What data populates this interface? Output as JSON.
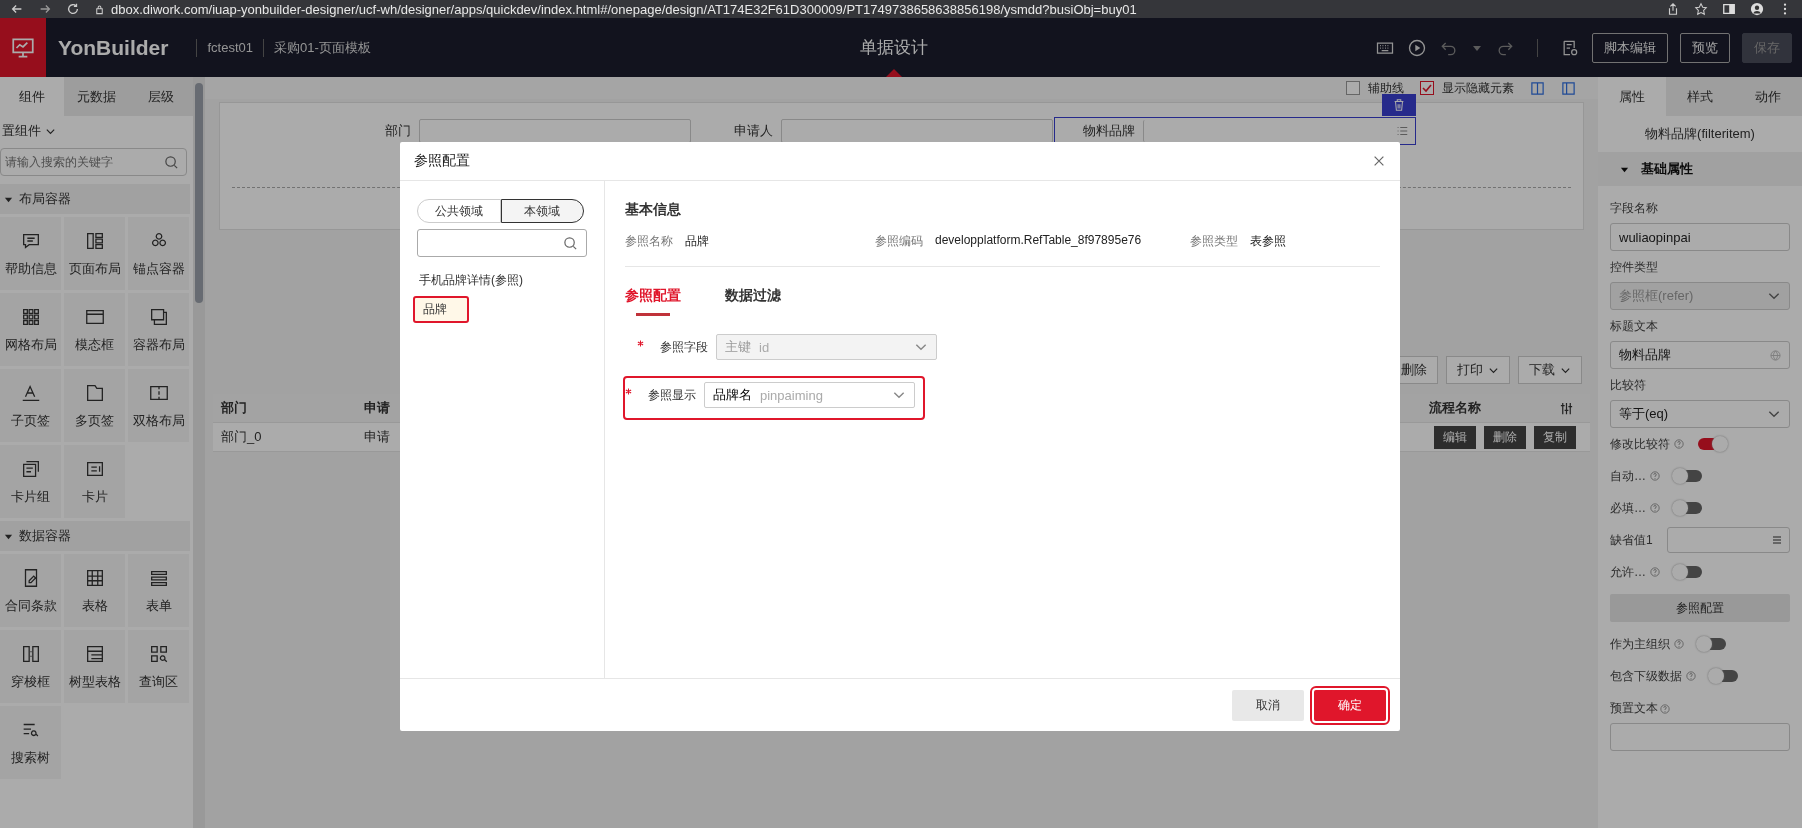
{
  "browser": {
    "url": "dbox.diwork.com/iuap-yonbuilder-designer/ucf-wh/designer/apps/quickdev/index.html#/onepage/design/AT174E32F61D300009/PT1749738658638856198/ysmdd?busiObj=buy01"
  },
  "header": {
    "brand": "YonBuilder",
    "app": "fctest01",
    "page": "采购01-页面模板",
    "center_title": "单据设计",
    "buttons": [
      {
        "label": "脚本编辑",
        "disabled": false
      },
      {
        "label": "预览",
        "disabled": false
      },
      {
        "label": "保存",
        "disabled": true
      }
    ]
  },
  "left_panel": {
    "tabs": [
      {
        "label": "组件",
        "selected": true
      },
      {
        "label": "元数据",
        "selected": false
      },
      {
        "label": "层级",
        "selected": false
      }
    ],
    "category": "置组件",
    "search": {
      "placeholder": "请输入搜索的关键字"
    },
    "sections": [
      {
        "title": "布局容器",
        "expanded": true,
        "items": [
          "帮助信息",
          "页面布局",
          "锚点容器",
          "网格布局",
          "模态框",
          "容器布局",
          "子页签",
          "多页签",
          "双格布局",
          "卡片组",
          "卡片"
        ]
      },
      {
        "title": "数据容器",
        "expanded": true,
        "items": [
          "合同条款",
          "表格",
          "表单",
          "穿梭框",
          "树型表格",
          "查询区",
          "搜索树"
        ]
      }
    ]
  },
  "canvas": {
    "options": [
      {
        "label": "辅助线",
        "checked": false
      },
      {
        "label": "显示隐藏元素",
        "checked": true
      }
    ],
    "filters": [
      {
        "label": "部门",
        "selected": false
      },
      {
        "label": "申请人",
        "selected": false
      },
      {
        "label": "物料品牌",
        "selected": true
      }
    ],
    "actions": [
      {
        "label": "删除",
        "kind": "button"
      },
      {
        "label": "打印",
        "kind": "dropdown"
      },
      {
        "label": "下载",
        "kind": "dropdown"
      }
    ],
    "table": {
      "columns": [
        "部门",
        "申请",
        "流程名称"
      ],
      "rows": [
        {
          "cells": [
            "部门_0",
            "申请"
          ],
          "actions": [
            "编辑",
            "删除",
            "复制"
          ]
        }
      ]
    }
  },
  "right_panel": {
    "tabs": [
      {
        "label": "属性",
        "selected": true
      },
      {
        "label": "样式",
        "selected": false
      },
      {
        "label": "动作",
        "selected": false
      }
    ],
    "title": "物料品牌(filteritem)",
    "section": {
      "title": "基础属性",
      "expanded": true
    },
    "fields": [
      {
        "kind": "input",
        "label": "字段名称",
        "value": "wuliaopinpai"
      },
      {
        "kind": "select",
        "label": "控件类型",
        "value": "参照框(refer)",
        "disabled": true
      },
      {
        "kind": "lang-input",
        "label": "标题文本",
        "value": "物料品牌"
      },
      {
        "kind": "select",
        "label": "比较符",
        "value": "等于(eq)",
        "disabled": false
      },
      {
        "kind": "toggle",
        "label": "修改比较符",
        "on": true,
        "help": true
      },
      {
        "kind": "toggle",
        "label": "自动…",
        "on": false,
        "help": true
      },
      {
        "kind": "toggle",
        "label": "必填…",
        "on": false,
        "help": true
      },
      {
        "kind": "lookup",
        "label": "缺省值1"
      },
      {
        "kind": "toggle",
        "label": "允许…",
        "on": false,
        "help": true
      },
      {
        "kind": "button",
        "label": "参照配置"
      },
      {
        "kind": "toggle",
        "label": "作为主组织",
        "on": false,
        "help": true
      },
      {
        "kind": "toggle",
        "label": "包含下级数据",
        "on": false,
        "help": true
      },
      {
        "kind": "textarea",
        "label": "预置文本",
        "help": true
      }
    ]
  },
  "dialog": {
    "title": "参照配置",
    "scopes": [
      {
        "label": "公共领域",
        "selected": false
      },
      {
        "label": "本领域",
        "selected": true
      }
    ],
    "references": [
      {
        "label": "手机品牌详情(参照)",
        "selected": false
      },
      {
        "label": "品牌",
        "selected": true
      }
    ],
    "section_title": "基本信息",
    "info": [
      {
        "label": "参照名称",
        "value": "品牌"
      },
      {
        "label": "参照编码",
        "value": "developplatform.RefTable_8f97895e76"
      },
      {
        "label": "参照类型",
        "value": "表参照"
      }
    ],
    "tabs": [
      {
        "label": "参照配置",
        "selected": true
      },
      {
        "label": "数据过滤",
        "selected": false
      }
    ],
    "fields": [
      {
        "label": "参照字段",
        "required": true,
        "name": "主键",
        "code": "id",
        "disabled": true,
        "highlighted": false
      },
      {
        "label": "参照显示",
        "required": true,
        "name": "品牌名",
        "code": "pinpaiming",
        "disabled": false,
        "highlighted": true
      }
    ],
    "buttons": [
      {
        "label": "取消",
        "kind": "secondary",
        "highlighted": false
      },
      {
        "label": "确定",
        "kind": "primary",
        "highlighted": true
      }
    ]
  }
}
